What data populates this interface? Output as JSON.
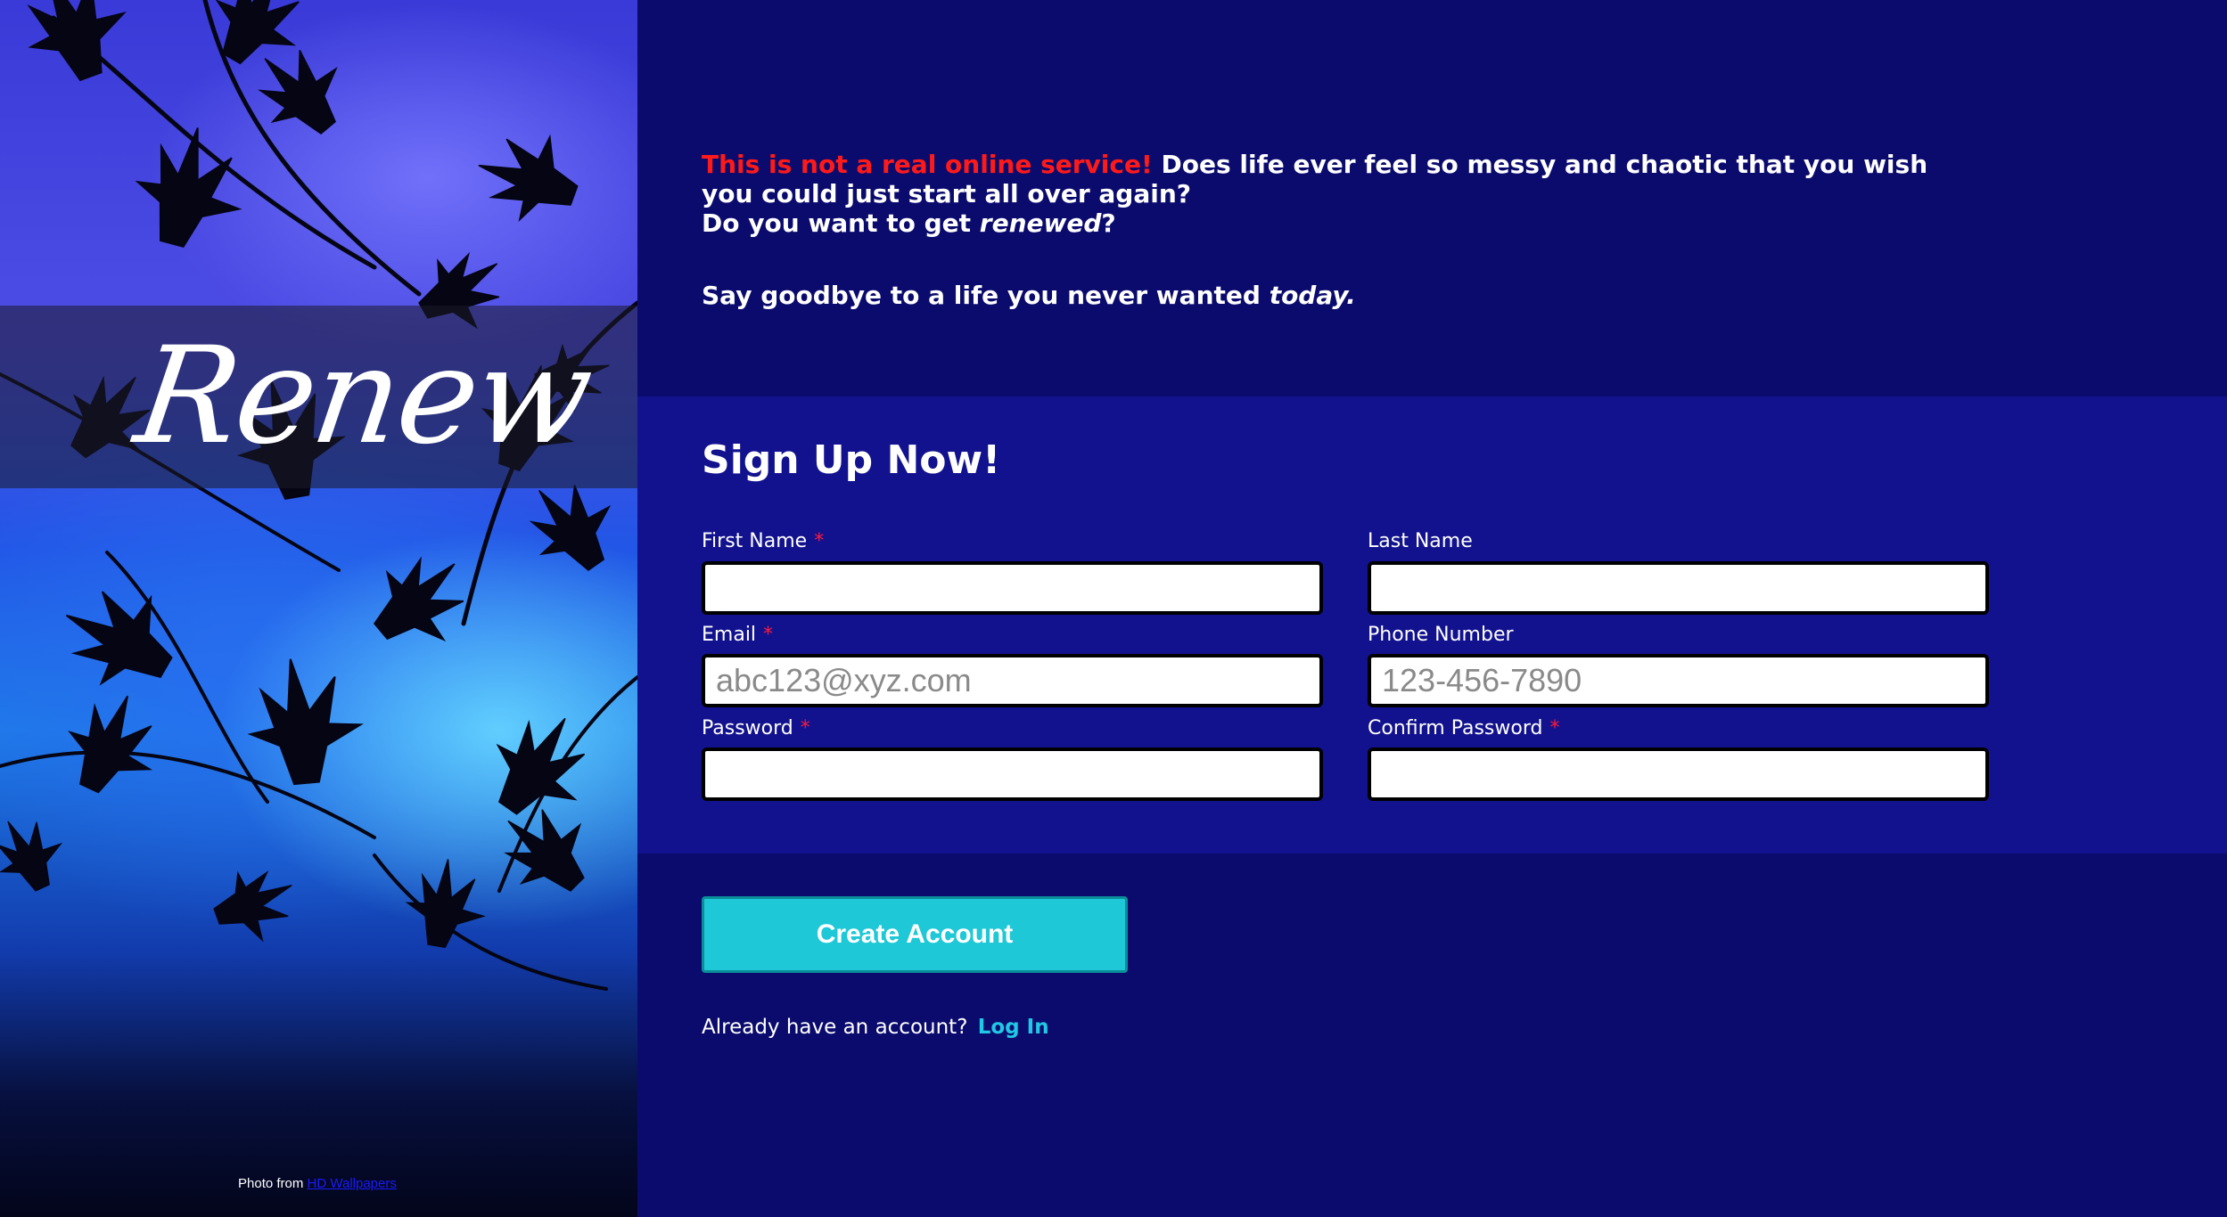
{
  "brand": {
    "logo_text": "Renew",
    "photo_credit_prefix": "Photo from",
    "photo_credit_link": "HD Wallpapers"
  },
  "intro": {
    "warning": "This is not a real online service!",
    "line1_rest": "Does life ever feel so messy and chaotic that you wish you could just start all over again?",
    "line2_prefix": "Do you want to get",
    "line2_emphasis": "renewed",
    "line2_suffix": "?",
    "tagline_prefix": "Say goodbye to a life you never wanted",
    "tagline_emphasis": "today."
  },
  "form": {
    "title": "Sign Up Now!",
    "required_marker": "*",
    "fields": {
      "first_name": {
        "label": "First Name",
        "placeholder": "",
        "value": ""
      },
      "last_name": {
        "label": "Last Name",
        "placeholder": "",
        "value": ""
      },
      "email": {
        "label": "Email",
        "placeholder": "abc123@xyz.com",
        "value": ""
      },
      "phone": {
        "label": "Phone Number",
        "placeholder": "123-456-7890",
        "value": ""
      },
      "password": {
        "label": "Password",
        "placeholder": "",
        "value": ""
      },
      "confirm_password": {
        "label": "Confirm Password",
        "placeholder": "",
        "value": ""
      }
    },
    "submit_label": "Create Account"
  },
  "login": {
    "prompt": "Already have an account?",
    "link_label": "Log In"
  },
  "colors": {
    "page_background": "#0b0b6e",
    "form_background": "#12128e",
    "warning": "#ff1a1a",
    "required": "#ff1a3a",
    "button": "#1ec8d6",
    "link": "#21c8e6"
  }
}
